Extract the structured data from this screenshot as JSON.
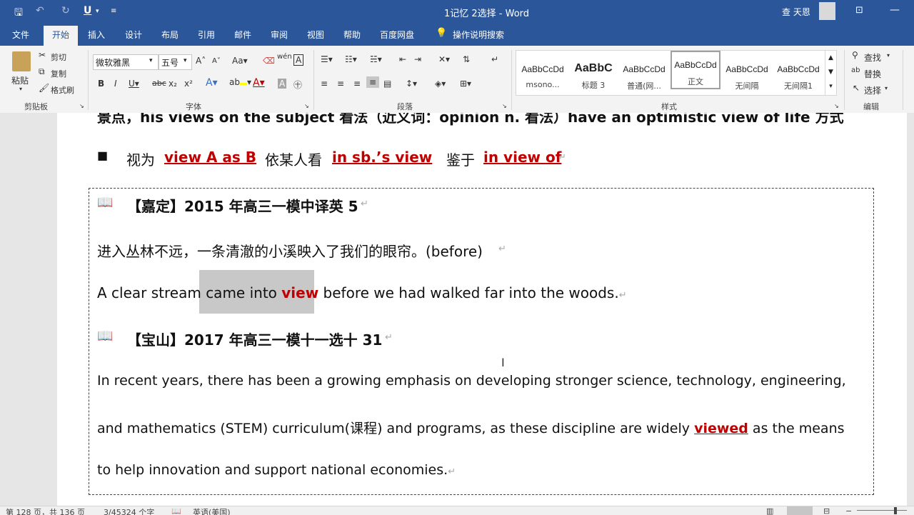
{
  "window": {
    "title": "1记忆 2选择  -  Word",
    "user": "查 天恩"
  },
  "qat": {
    "save_icon": "save-icon",
    "undo_icon": "undo-icon",
    "redo_icon": "redo-icon",
    "underline_label": "U"
  },
  "tabs": [
    {
      "label": "文件"
    },
    {
      "label": "开始"
    },
    {
      "label": "插入"
    },
    {
      "label": "设计"
    },
    {
      "label": "布局"
    },
    {
      "label": "引用"
    },
    {
      "label": "邮件"
    },
    {
      "label": "审阅"
    },
    {
      "label": "视图"
    },
    {
      "label": "帮助"
    },
    {
      "label": "百度网盘"
    },
    {
      "label": "操作说明搜索"
    }
  ],
  "clipboard": {
    "paste": "粘贴",
    "cut": "剪切",
    "copy": "复制",
    "format_painter": "格式刷",
    "group": "剪贴板"
  },
  "font": {
    "name": "微软雅黑",
    "size": "五号",
    "group": "字体"
  },
  "paragraph": {
    "group": "段落"
  },
  "styles": {
    "group": "样式",
    "items": [
      {
        "sample": "AaBbCcDd",
        "name": "msono..."
      },
      {
        "sample": "AaBbC",
        "name": "标题 3"
      },
      {
        "sample": "AaBbCcDd",
        "name": "普通(网..."
      },
      {
        "sample": "AaBbCcDd",
        "name": "正文"
      },
      {
        "sample": "AaBbCcDd",
        "name": "无间隔"
      },
      {
        "sample": "AaBbCcDd",
        "name": "无间隔1"
      }
    ]
  },
  "editing": {
    "find": "查找",
    "replace": "替换",
    "select": "选择",
    "group": "编辑"
  },
  "doc": {
    "line0": "景点，his views on the subject 看法（近义词：opinion n. 看法）have an optimistic view of life 方式",
    "line1_a": "视为",
    "line1_b": "view A as B",
    "line1_c": "依某人看",
    "line1_d": "in sb.’s view",
    "line1_e": "鉴于",
    "line1_f": "in view of",
    "h1": "【嘉定】2015 年高三一模中译英 5",
    "cn1": "进入丛林不远，一条清澈的小溪映入了我们的眼帘。(before)",
    "en1_a": "A clear stream ",
    "en1_b": "came into ",
    "en1_c": "view",
    "en1_d": " before we had walked far into the woods.",
    "h2": "【宝山】2017 年高三一模十一选十 31",
    "p1": "In recent years, there has been a growing emphasis on developing stronger science, technology, engineering,",
    "p2_a": "and mathematics (STEM) curriculum(课程) and programs, as these discipline are widely ",
    "p2_b": "viewed",
    "p2_c": " as the means",
    "p3": "to help innovation and support national economies."
  },
  "status": {
    "page": "第 128 页，共 136 页",
    "words": "3/45324 个字",
    "lang": "英语(美国)"
  }
}
